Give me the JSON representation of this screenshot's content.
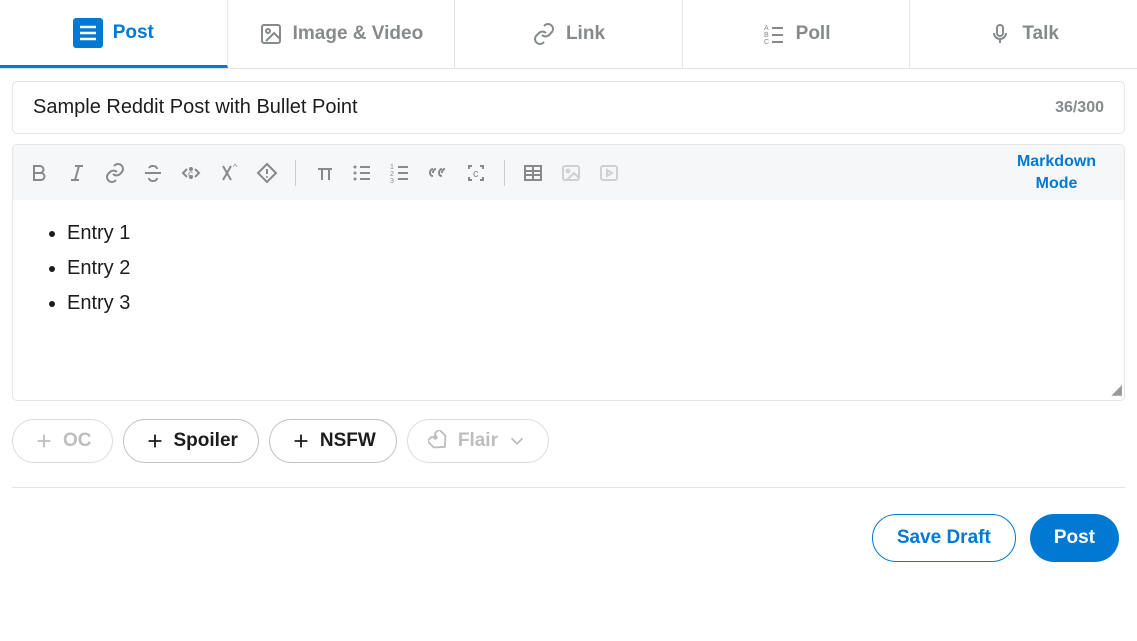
{
  "tabs": {
    "post": "Post",
    "image_video": "Image & Video",
    "link": "Link",
    "poll": "Poll",
    "talk": "Talk"
  },
  "title": {
    "value": "Sample Reddit Post with Bullet Point",
    "counter": "36/300"
  },
  "markdown_mode": "Markdown Mode",
  "content": {
    "items": [
      "Entry 1",
      "Entry 2",
      "Entry 3"
    ]
  },
  "tags": {
    "oc": "OC",
    "spoiler": "Spoiler",
    "nsfw": "NSFW",
    "flair": "Flair"
  },
  "actions": {
    "save_draft": "Save Draft",
    "post": "Post"
  }
}
